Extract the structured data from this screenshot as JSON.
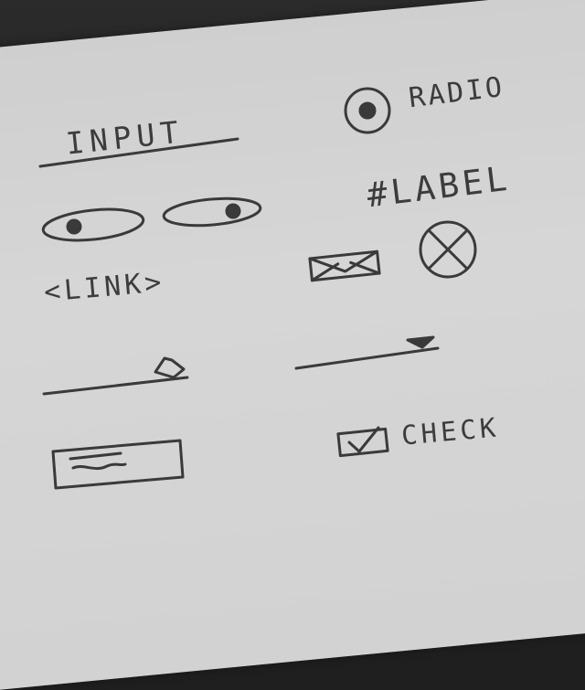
{
  "sketch": {
    "input_label": "INPUT",
    "radio_label": "RADIO",
    "label_text": "#LABEL",
    "link_text": "<LINK>",
    "check_label": "CHECK",
    "icons": [
      "radio-icon",
      "toggle-on-icon",
      "toggle-off-icon",
      "envelope-icon",
      "close-circle-icon",
      "slider-handle-icon",
      "dropdown-caret-icon",
      "checkbox-checked-icon",
      "textarea-icon"
    ]
  }
}
